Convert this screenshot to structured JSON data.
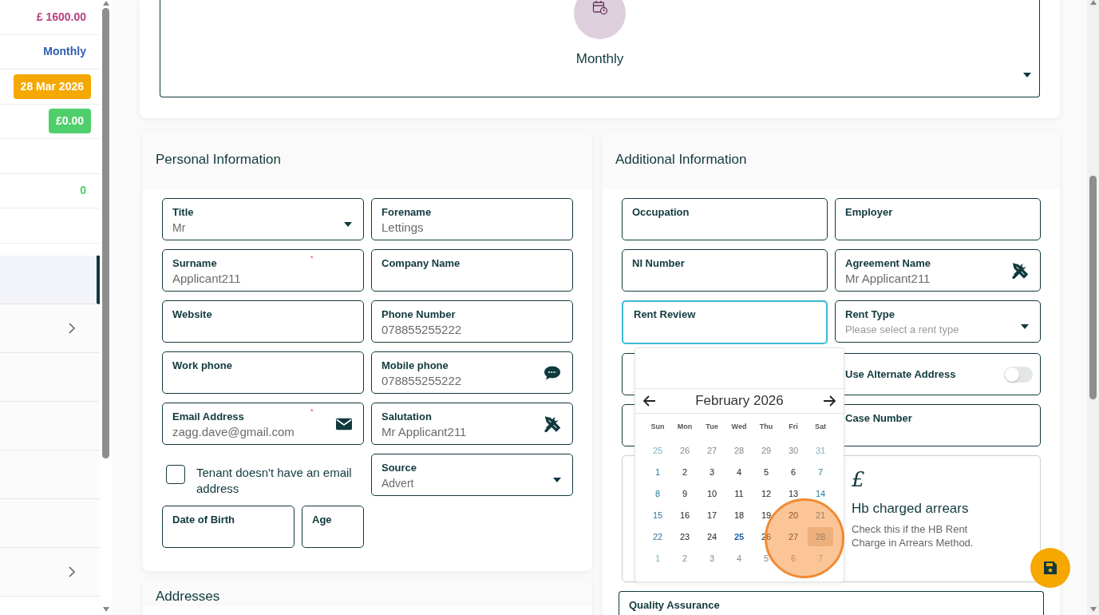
{
  "sidebar": {
    "values": [
      {
        "kind": "text",
        "text": "£ 1600.00",
        "color": "#b83f80"
      },
      {
        "kind": "text",
        "text": "Monthly",
        "color": "#2f5fb3"
      },
      {
        "kind": "badge",
        "text": "28 Mar 2026",
        "color": "#f5a800"
      },
      {
        "kind": "badge",
        "text": "£0.00",
        "color": "#4fcf6b"
      },
      {
        "kind": "empty"
      },
      {
        "kind": "text",
        "text": "0",
        "color": "#4fcf6b"
      },
      {
        "kind": "empty"
      }
    ],
    "nav_rows": [
      {
        "selected": true,
        "expandable": false
      },
      {
        "selected": false,
        "expandable": true
      },
      {
        "selected": false,
        "expandable": false
      },
      {
        "selected": false,
        "expandable": false
      },
      {
        "selected": false,
        "expandable": false
      },
      {
        "selected": false,
        "expandable": false
      },
      {
        "selected": false,
        "expandable": true
      }
    ]
  },
  "frequency": {
    "label": "Monthly"
  },
  "personal": {
    "title": "Personal Information",
    "fields": [
      {
        "kind": "select",
        "label": "Title",
        "value": "Mr"
      },
      {
        "kind": "input",
        "label": "Forename",
        "value": "Lettings"
      },
      {
        "kind": "input",
        "label": "Surname",
        "value": "Applicant211",
        "required_mark": "*"
      },
      {
        "kind": "input",
        "label": "Company Name"
      },
      {
        "kind": "input",
        "label": "Website"
      },
      {
        "kind": "input",
        "label": "Phone Number",
        "value": "078855255222"
      },
      {
        "kind": "input",
        "label": "Work phone"
      },
      {
        "kind": "input",
        "label": "Mobile phone",
        "value": "078855255222",
        "addon": {
          "kind": "sms"
        }
      },
      {
        "kind": "input",
        "label": "Email Address",
        "value": "zagg.dave@gmail.com",
        "required_mark": "*",
        "addon": {
          "kind": "email"
        }
      },
      {
        "kind": "input",
        "label": "Salutation",
        "value": "Mr Applicant211",
        "addon": {
          "kind": "generate"
        }
      },
      {
        "kind": "checkbox",
        "label": "Tenant doesn't have an email address",
        "checked": false
      },
      {
        "kind": "select",
        "label": "Source",
        "value": "Advert"
      },
      {
        "kind": "short_input",
        "label": "Date of Birth"
      },
      {
        "kind": "short_input",
        "label": "Age"
      }
    ]
  },
  "addresses": {
    "title": "Addresses"
  },
  "additional": {
    "title": "Additional Information",
    "fields": [
      {
        "kind": "input",
        "label": "Occupation",
        "focused": false
      },
      {
        "kind": "input",
        "label": "Employer",
        "focused": false
      },
      {
        "kind": "input",
        "label": "NI Number",
        "focused": false
      },
      {
        "kind": "input",
        "label": "Agreement Name",
        "value": "Mr Applicant211",
        "addon": {
          "kind": "generate"
        },
        "focused": false
      },
      {
        "kind": "input",
        "label": "Rent Review",
        "focused": true
      },
      {
        "kind": "select",
        "label": "Rent Type",
        "placeholder": "Please select a rent type",
        "focused": false
      },
      {
        "kind": "blank"
      },
      {
        "kind": "toggle",
        "label": "Use Alternate Address",
        "on": false
      },
      {
        "kind": "blank"
      },
      {
        "kind": "input",
        "label": "Case Number",
        "focused": false
      },
      {
        "kind": "blank_tall"
      },
      {
        "kind": "option_card",
        "symbol": "£",
        "title": "Hb charged arrears",
        "description": "Check this if the HB Rent Charge in Arrears Method."
      },
      {
        "kind": "wide_input",
        "label": "Quality Assurance",
        "focused": false
      }
    ],
    "calendar": {
      "month": "February 2026",
      "weekdays": [
        "Sun",
        "Mon",
        "Tue",
        "Wed",
        "Thu",
        "Fri",
        "Sat"
      ],
      "weeks": [
        [
          {
            "d": "25",
            "muted": true,
            "today": false,
            "selected": false
          },
          {
            "d": "26",
            "muted": true,
            "today": false,
            "selected": false
          },
          {
            "d": "27",
            "muted": true,
            "today": false,
            "selected": false
          },
          {
            "d": "28",
            "muted": true,
            "today": false,
            "selected": false
          },
          {
            "d": "29",
            "muted": true,
            "today": false,
            "selected": false
          },
          {
            "d": "30",
            "muted": true,
            "today": false,
            "selected": false
          },
          {
            "d": "31",
            "muted": true,
            "today": false,
            "selected": false
          }
        ],
        [
          {
            "d": "1",
            "muted": false,
            "today": false,
            "selected": false
          },
          {
            "d": "2",
            "muted": false,
            "today": false,
            "selected": false
          },
          {
            "d": "3",
            "muted": false,
            "today": false,
            "selected": false
          },
          {
            "d": "4",
            "muted": false,
            "today": false,
            "selected": false
          },
          {
            "d": "5",
            "muted": false,
            "today": false,
            "selected": false
          },
          {
            "d": "6",
            "muted": false,
            "today": false,
            "selected": false
          },
          {
            "d": "7",
            "muted": false,
            "today": false,
            "selected": false
          }
        ],
        [
          {
            "d": "8",
            "muted": false,
            "today": false,
            "selected": false
          },
          {
            "d": "9",
            "muted": false,
            "today": false,
            "selected": false
          },
          {
            "d": "10",
            "muted": false,
            "today": false,
            "selected": false
          },
          {
            "d": "11",
            "muted": false,
            "today": false,
            "selected": false
          },
          {
            "d": "12",
            "muted": false,
            "today": false,
            "selected": false
          },
          {
            "d": "13",
            "muted": false,
            "today": false,
            "selected": false
          },
          {
            "d": "14",
            "muted": false,
            "today": false,
            "selected": false
          }
        ],
        [
          {
            "d": "15",
            "muted": false,
            "today": false,
            "selected": false
          },
          {
            "d": "16",
            "muted": false,
            "today": false,
            "selected": false
          },
          {
            "d": "17",
            "muted": false,
            "today": false,
            "selected": false
          },
          {
            "d": "18",
            "muted": false,
            "today": false,
            "selected": false
          },
          {
            "d": "19",
            "muted": false,
            "today": false,
            "selected": false
          },
          {
            "d": "20",
            "muted": false,
            "today": false,
            "selected": false
          },
          {
            "d": "21",
            "muted": false,
            "today": false,
            "selected": false
          }
        ],
        [
          {
            "d": "22",
            "muted": false,
            "today": false,
            "selected": false
          },
          {
            "d": "23",
            "muted": false,
            "today": false,
            "selected": false
          },
          {
            "d": "24",
            "muted": false,
            "today": false,
            "selected": false
          },
          {
            "d": "25",
            "muted": false,
            "today": true,
            "selected": false
          },
          {
            "d": "26",
            "muted": false,
            "today": false,
            "selected": false
          },
          {
            "d": "27",
            "muted": false,
            "today": false,
            "selected": false
          },
          {
            "d": "28",
            "muted": false,
            "today": false,
            "selected": true
          }
        ],
        [
          {
            "d": "1",
            "muted": true,
            "today": false,
            "selected": false
          },
          {
            "d": "2",
            "muted": true,
            "today": false,
            "selected": false
          },
          {
            "d": "3",
            "muted": true,
            "today": false,
            "selected": false
          },
          {
            "d": "4",
            "muted": true,
            "today": false,
            "selected": false
          },
          {
            "d": "5",
            "muted": true,
            "today": false,
            "selected": false
          },
          {
            "d": "6",
            "muted": true,
            "today": false,
            "selected": false
          },
          {
            "d": "7",
            "muted": true,
            "today": false,
            "selected": false
          }
        ]
      ]
    }
  }
}
